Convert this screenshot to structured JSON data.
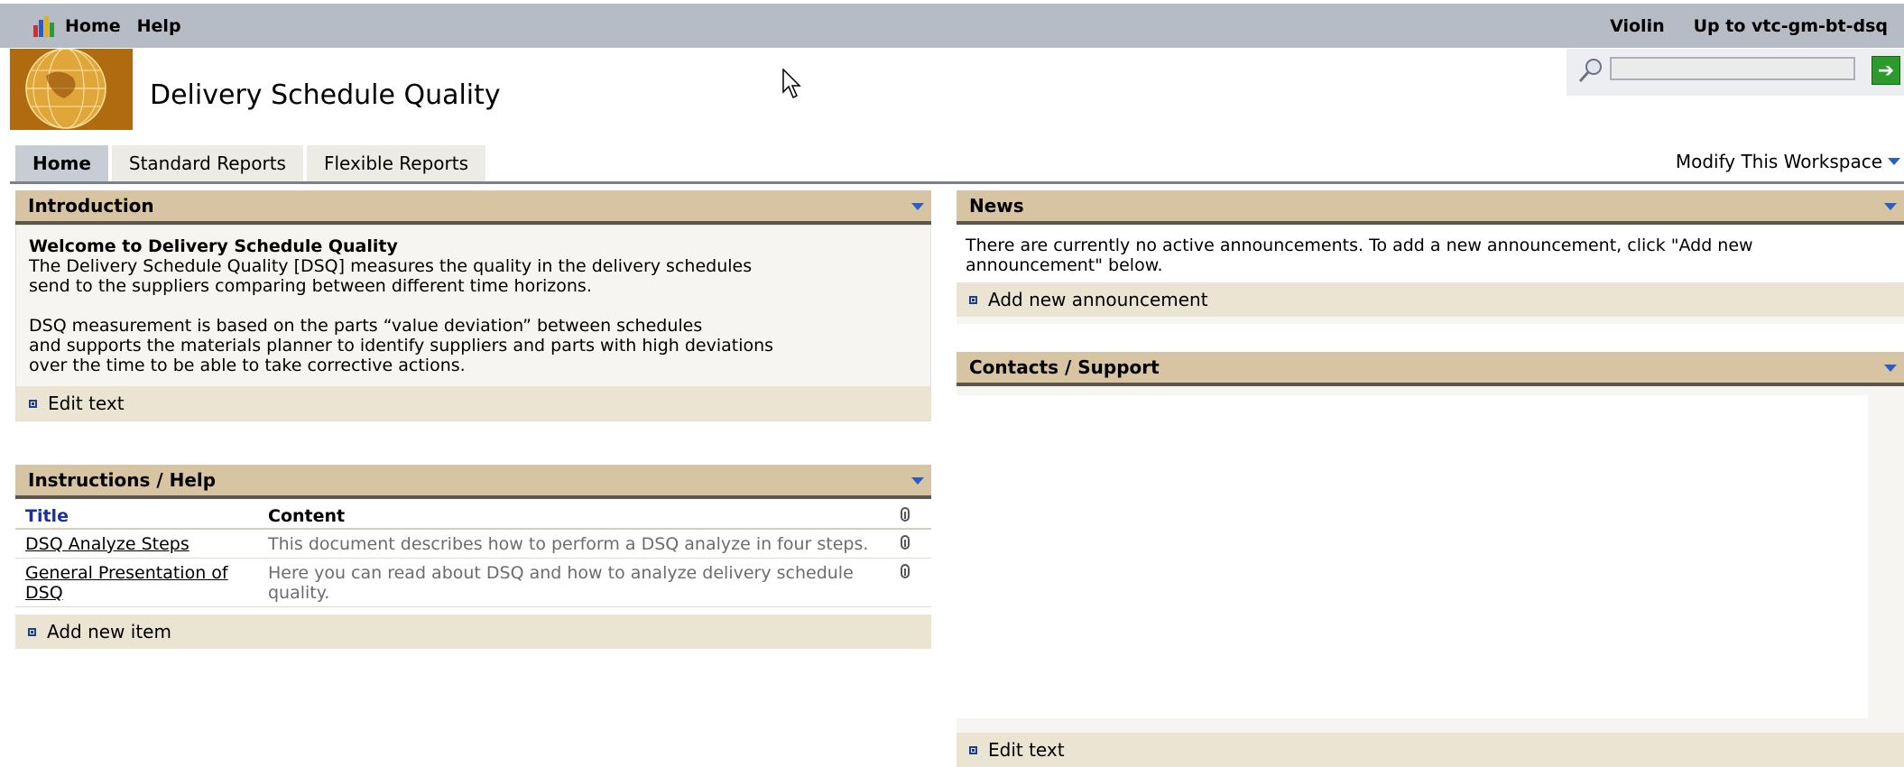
{
  "topbar": {
    "menu": [
      "Home",
      "Help"
    ],
    "user": "Violin",
    "up_link": "Up to vtc-gm-bt-dsq"
  },
  "header": {
    "title": "Delivery Schedule Quality",
    "search_placeholder": ""
  },
  "tabs": [
    {
      "label": "Home",
      "active": true
    },
    {
      "label": "Standard Reports",
      "active": false
    },
    {
      "label": "Flexible Reports",
      "active": false
    }
  ],
  "modify_workspace": "Modify This Workspace",
  "introduction": {
    "header": "Introduction",
    "welcome": "Welcome to Delivery Schedule Quality",
    "para1": [
      "The Delivery Schedule Quality [DSQ] measures the quality in the delivery schedules",
      "send to the suppliers comparing between different time horizons."
    ],
    "para2": [
      "DSQ measurement is based on the parts “value deviation” between schedules",
      "and supports the materials planner to identify suppliers and parts with high deviations",
      "over the time to be able to take corrective actions."
    ],
    "action": "Edit text"
  },
  "instructions": {
    "header": "Instructions / Help",
    "columns": {
      "title": "Title",
      "content": "Content"
    },
    "rows": [
      {
        "title": "DSQ Analyze Steps",
        "content": "This document describes how to perform a DSQ analyze in four steps."
      },
      {
        "title": "General Presentation of DSQ",
        "content": "Here you can read about DSQ and how to analyze delivery schedule quality."
      }
    ],
    "action": "Add new item"
  },
  "news": {
    "header": "News",
    "text": "There are currently no active announcements. To add a new announcement, click \"Add new announcement\" below.",
    "action": "Add new announcement"
  },
  "contacts": {
    "header": "Contacts / Support",
    "action": "Edit text"
  }
}
